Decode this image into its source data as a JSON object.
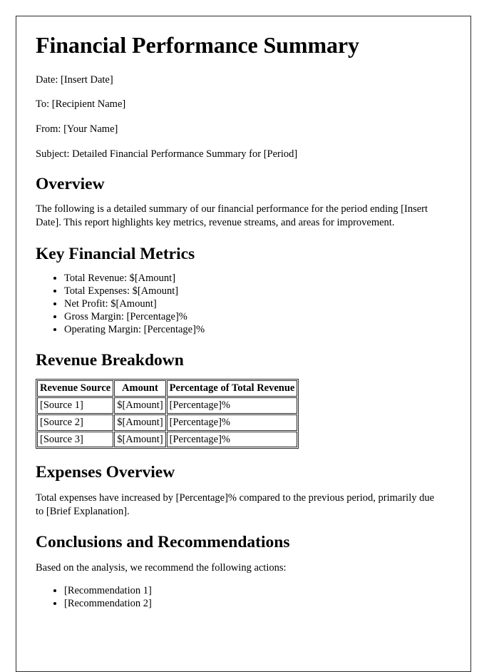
{
  "document": {
    "title": "Financial Performance Summary",
    "meta_lines": [
      "Date: [Insert Date]",
      "To: [Recipient Name]",
      "From: [Your Name]",
      "Subject: Detailed Financial Performance Summary for [Period]"
    ],
    "sections": {
      "overview": {
        "heading": "Overview",
        "paragraph": "The following is a detailed summary of our financial performance for the period ending [Insert Date]. This report highlights key metrics, revenue streams, and areas for improvement."
      },
      "key_metrics": {
        "heading": "Key Financial Metrics",
        "items": [
          "Total Revenue: $[Amount]",
          "Total Expenses: $[Amount]",
          "Net Profit: $[Amount]",
          "Gross Margin: [Percentage]%",
          "Operating Margin: [Percentage]%"
        ]
      },
      "revenue_breakdown": {
        "heading": "Revenue Breakdown",
        "table": {
          "columns": [
            "Revenue Source",
            "Amount",
            "Percentage of Total Revenue"
          ],
          "rows": [
            [
              "[Source 1]",
              "$[Amount]",
              "[Percentage]%"
            ],
            [
              "[Source 2]",
              "$[Amount]",
              "[Percentage]%"
            ],
            [
              "[Source 3]",
              "$[Amount]",
              "[Percentage]%"
            ]
          ]
        }
      },
      "expenses_overview": {
        "heading": "Expenses Overview",
        "paragraph": "Total expenses have increased by [Percentage]% compared to the previous period, primarily due to [Brief Explanation]."
      },
      "conclusions": {
        "heading": "Conclusions and Recommendations",
        "lead_in": "Based on the analysis, we recommend the following actions:",
        "items": [
          "[Recommendation 1]",
          "[Recommendation 2]"
        ]
      }
    }
  },
  "theme": {
    "page_background": "#ffffff",
    "text_color": "#000000",
    "border_color": "#2b2b2b"
  }
}
